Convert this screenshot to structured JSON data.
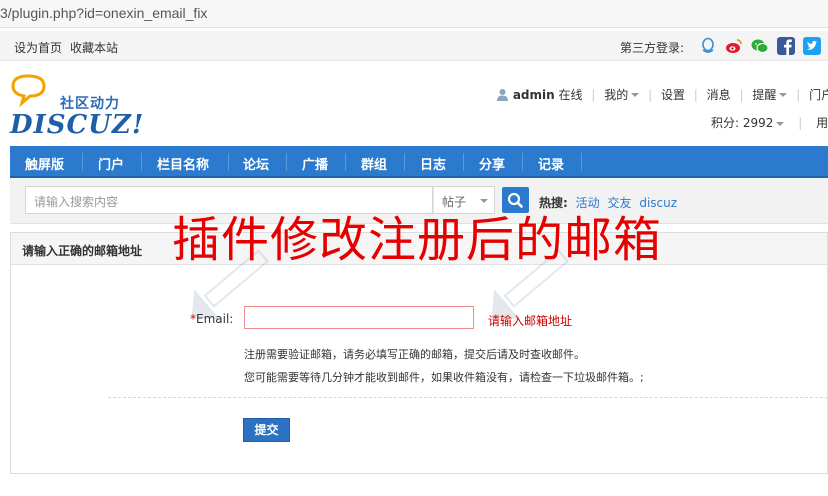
{
  "address_bar": {
    "url": "3/plugin.php?id=onexin_email_fix"
  },
  "toolbar": {
    "set_home": "设为首页",
    "bookmark": "收藏本站",
    "third_party_label": "第三方登录:",
    "login_icons": [
      "qq-icon",
      "weibo-icon",
      "wechat-icon",
      "facebook-icon",
      "twitter-icon"
    ]
  },
  "logo": {
    "text": "社区动力",
    "word": "DISCUZ!"
  },
  "user_menu": {
    "username": "admin",
    "online": "在线",
    "mine": "我的",
    "settings": "设置",
    "messages": "消息",
    "remind": "提醒",
    "portal_manage": "门户管理",
    "credits": "积分: 2992",
    "user_group": "用"
  },
  "nav": {
    "items": [
      "触屏版",
      "门户",
      "栏目名称",
      "论坛",
      "广播",
      "群组",
      "日志",
      "分享",
      "记录"
    ]
  },
  "search": {
    "placeholder": "请输入搜索内容",
    "type": "帖子",
    "hot_label": "热搜:",
    "hot_links": [
      "活动",
      "交友",
      "discuz"
    ]
  },
  "panel": {
    "title": "请输入正确的邮箱地址",
    "overlay_title": "插件修改注册后的邮箱",
    "email_label": "Email:",
    "required_mark": "*",
    "email_value": "",
    "error_text": "请输入邮箱地址",
    "note_1": "注册需要验证邮箱，请务必填写正确的邮箱，提交后请及时查收邮件。",
    "note_2": "您可能需要等待几分钟才能收到邮件，如果收件箱没有，请检查一下垃圾邮件箱。;",
    "submit": "提交"
  },
  "colors": {
    "nav_blue": "#2b7acd",
    "overlay_red": "#e60000",
    "error_red": "#cc0000"
  }
}
